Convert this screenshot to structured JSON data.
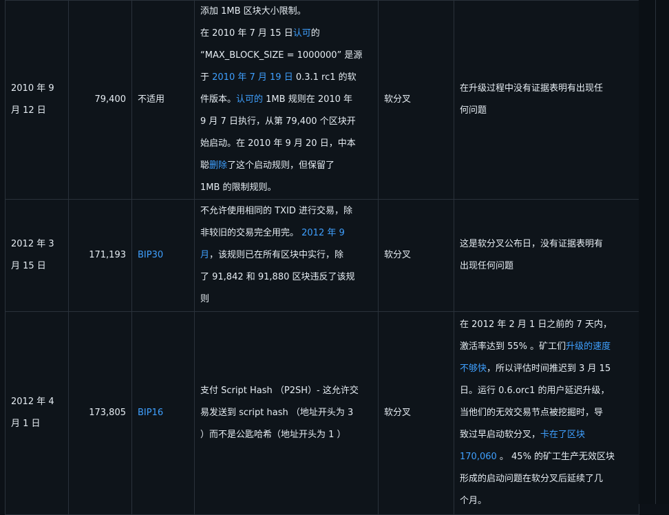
{
  "rows": [
    {
      "date_line1": "2010 年 9",
      "date_line2": "月 12 日",
      "height": "79,400",
      "bip": "不适用",
      "desc": {
        "p1": "添加 1MB 区块大小限制。",
        "p2a": "在 2010 年 7 月 15 日",
        "p2link": "认可",
        "p2b": "的",
        "p3": "“MAX_BLOCK_SIZE = 1000000” 是源",
        "p4a": "于 ",
        "p4link": "2010 年 7 月 19 日",
        "p4b": " 0.3.1 rc1 的软",
        "p5": "件版本。",
        "p5link": "认可的",
        "p5b": " 1MB 规则在 2010 年",
        "p6": "9 月 7 日执行，从第 79,400 个区块开",
        "p7": "始启动。在 2010 年 9 月 20 日，中本",
        "p8a": "聪",
        "p8link": "删除",
        "p8b": "了这个启动规则，但保留了",
        "p9": "1MB 的限制规则。"
      },
      "type": "软分叉",
      "notes": {
        "l1": "在升级过程中没有证据表明有出现任",
        "l2": "何问题"
      }
    },
    {
      "date_line1": "2012 年 3",
      "date_line2": "月 15 日",
      "height": "171,193",
      "bip": "BIP30",
      "desc": {
        "l1": "不允许使用相同的 TXID 进行交易，除",
        "l2a": "非较旧的交易完全用完。 ",
        "l2link": "2012 年 9",
        "l3link": "月",
        "l3b": "，该规则已在所有区块中实行，除",
        "l4": "了 91,842 和 91,880 区块违反了该规",
        "l5": "则"
      },
      "type": "软分叉",
      "notes": {
        "l1": "这是软分叉公布日，没有证据表明有",
        "l2": "出现任何问题"
      }
    },
    {
      "date_line1": "2012 年 4",
      "date_line2": "月 1 日",
      "height": "173,805",
      "bip": "BIP16",
      "desc": {
        "l1": "支付 Script Hash （P2SH）- 这允许交",
        "l2": "易发送到 script hash （地址开头为 3",
        "l3": "）而不是公匙哈希（地址开头为 1 ）"
      },
      "type": "软分叉",
      "notes": {
        "l1": "在 2012 年 2 月 1 日之前的 7 天内，",
        "l2a": "激活率达到 55% 。矿工们",
        "l2link": "升级的速度",
        "l3link": "不够快",
        "l3b": "，所以评估时间推迟到 3 月 15",
        "l4": "日。运行 0.6.orc1 的用户延迟升级，",
        "l5": "当他们的无效交易节点被挖掘时，导",
        "l6a": "致过早启动软分叉，",
        "l6link": "卡在了区块",
        "l7link": "170,060",
        "l7b": " 。 45% 的矿工生产无效区块",
        "l8": "形成的启动问题在软分叉后延续了几",
        "l9": "个月。"
      }
    }
  ]
}
